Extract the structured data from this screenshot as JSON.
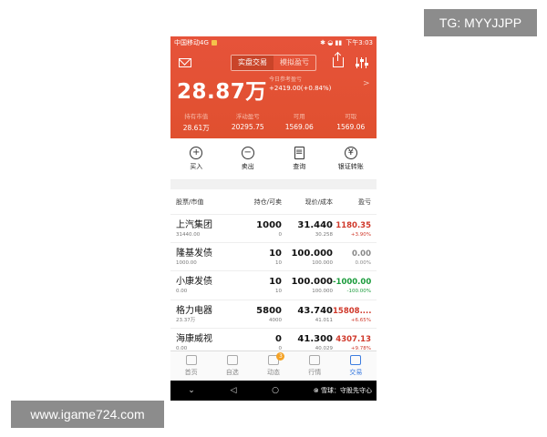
{
  "watermark": {
    "tg": "TG: MYYJJPP",
    "site": "www.igame724.com"
  },
  "status_bar": {
    "carrier": "中国移动4G",
    "time": "下午3:03"
  },
  "topbar": {
    "tab_real": "实盘交易",
    "tab_sim": "模拟盈亏"
  },
  "summary": {
    "total": "28.87万",
    "today_label": "今日参考盈亏",
    "today_value": "+2419.00(+0.84%)"
  },
  "stats": [
    {
      "label": "持有市值",
      "value": "28.61万"
    },
    {
      "label": "浮动盈亏",
      "value": "20295.75"
    },
    {
      "label": "可用",
      "value": "1569.06"
    },
    {
      "label": "可取",
      "value": "1569.06"
    }
  ],
  "actions": [
    {
      "label": "买入",
      "icon": "plus-circle-icon",
      "glyph": "+"
    },
    {
      "label": "卖出",
      "icon": "minus-circle-icon",
      "glyph": "−"
    },
    {
      "label": "查询",
      "icon": "document-icon",
      "glyph": "≡"
    },
    {
      "label": "银证转账",
      "icon": "yen-transfer-icon",
      "glyph": "¥"
    }
  ],
  "table": {
    "headers": [
      "股票/市值",
      "持仓/可卖",
      "现价/成本",
      "盈亏"
    ],
    "rows": [
      {
        "name": "上汽集团",
        "mv": "31440.00",
        "hold": "1000",
        "avail": "0",
        "price": "31.440",
        "cost": "30.258",
        "pl": "1180.35",
        "plp": "+3.90%",
        "color": "#d0392b"
      },
      {
        "name": "隆基发债",
        "mv": "1000.00",
        "hold": "10",
        "avail": "10",
        "price": "100.000",
        "cost": "100.000",
        "pl": "0.00",
        "plp": "0.00%",
        "color": "#888888"
      },
      {
        "name": "小康发债",
        "mv": "0.00",
        "hold": "10",
        "avail": "10",
        "price": "100.000",
        "cost": "100.000",
        "pl": "-1000.00",
        "plp": "-100.00%",
        "color": "#1a9b3b"
      },
      {
        "name": "格力电器",
        "mv": "23.37万",
        "hold": "5800",
        "avail": "4000",
        "price": "43.740",
        "cost": "41.011",
        "pl": "15808....",
        "plp": "+6.65%",
        "color": "#d0392b"
      },
      {
        "name": "海康威视",
        "mv": "0.00",
        "hold": "0",
        "avail": "0",
        "price": "41.300",
        "cost": "40.029",
        "pl": "4307.13",
        "plp": "+9.78%",
        "color": "#d0392b"
      }
    ]
  },
  "tabbar": [
    {
      "label": "首页",
      "icon": "home-icon"
    },
    {
      "label": "自选",
      "icon": "image-icon"
    },
    {
      "label": "动态",
      "icon": "feed-icon",
      "badge": "3"
    },
    {
      "label": "行情",
      "icon": "bar-chart-icon"
    },
    {
      "label": "交易",
      "icon": "trade-arrows-icon",
      "active": true
    }
  ],
  "navbar": {
    "caption": "⊗ 雪球：守股先守心"
  },
  "colors": {
    "header": "#e0502f",
    "active_tab": "#3d7de0",
    "up": "#d0392b",
    "down": "#1a9b3b"
  }
}
